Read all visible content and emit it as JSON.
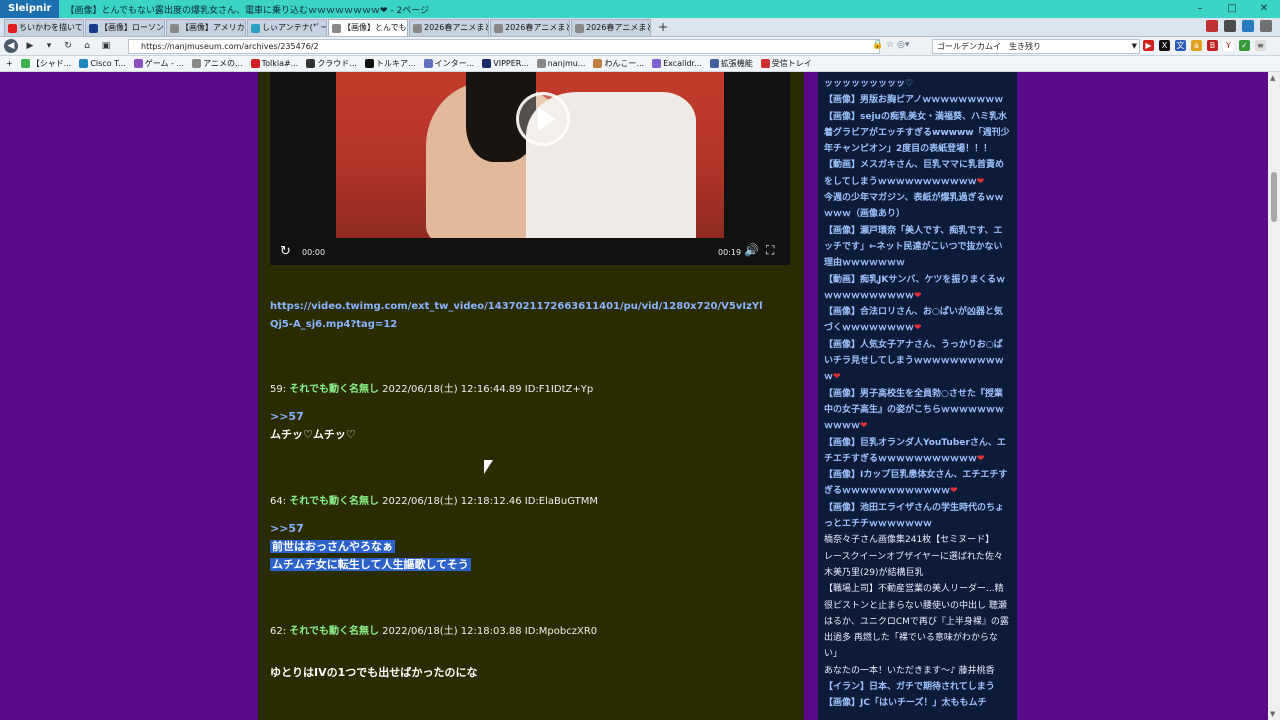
{
  "window": {
    "app_name": "Sleipnir",
    "title": "【画像】とんでもない露出度の爆乳女さん、電車に乗り込むｗｗｗｗｗｗｗｗ❤ - 2ページ",
    "controls": {
      "minimize": "–",
      "maximize": "□",
      "close": "✕"
    }
  },
  "tabs": [
    {
      "label": "ちいかわを描いて...",
      "color": "#e02020",
      "active": false
    },
    {
      "label": "【画像】ローソンの...",
      "color": "#1a3c8c",
      "active": false
    },
    {
      "label": "【画像】アメリカの...",
      "color": "#888888",
      "active": false
    },
    {
      "label": "しぃアンテナ(*ﾟー)",
      "color": "#2aa0c0",
      "active": false
    },
    {
      "label": "【画像】とんでもな...",
      "color": "#888888",
      "active": true
    },
    {
      "label": "2026春アニメまと...",
      "color": "#888888",
      "active": false
    },
    {
      "label": "2026春アニメまと...",
      "color": "#888888",
      "active": false
    },
    {
      "label": "2026春アニメまと...",
      "color": "#888888",
      "active": false
    }
  ],
  "tab_new": "+",
  "address": {
    "url": "https://nanjmuseum.com/archives/235476/2",
    "search_value": "ゴールデンカムイ　生き残り"
  },
  "bookmarks": [
    {
      "label": "【シャド...",
      "color": "#3cb04a"
    },
    {
      "label": "Cisco T...",
      "color": "#1e88c0"
    },
    {
      "label": "ゲーム - ...",
      "color": "#8a50c0"
    },
    {
      "label": "アニメの...",
      "color": "#888888"
    },
    {
      "label": "Tolkia#...",
      "color": "#d02020"
    },
    {
      "label": "クラウド...",
      "color": "#333333"
    },
    {
      "label": "トルキア...",
      "color": "#111111"
    },
    {
      "label": "インター...",
      "color": "#6070c0"
    },
    {
      "label": "VIPPER...",
      "color": "#1a2a6c"
    },
    {
      "label": "nanjmu...",
      "color": "#888888"
    },
    {
      "label": "わんこー...",
      "color": "#c08040"
    },
    {
      "label": "Excalidr...",
      "color": "#7a60d0"
    },
    {
      "label": "拡張機能",
      "color": "#4060a0"
    },
    {
      "label": "受信トレイ",
      "color": "#d03030"
    }
  ],
  "video": {
    "time_current": "00:00",
    "time_duration": "00:19"
  },
  "video_link": "https://video.twimg.com/ext_tw_video/1437021172663611401/pu/vid/1280x720/V5vIzYlQj5-A_sj6.mp4?tag=12",
  "posts": [
    {
      "number": "59:",
      "name": "それでも動く名無し",
      "datetime": "2022/06/18(土) 12:16:44.89 ID:F1IDtZ+Yp",
      "ref": ">>57",
      "lines": [
        "ムチッ♡ムチッ♡"
      ]
    },
    {
      "number": "64:",
      "name": "それでも動く名無し",
      "datetime": "2022/06/18(土) 12:18:12.46 ID:ElaBuGTMM",
      "ref": ">>57",
      "lines": [
        "前世はおっさんやろなぁ",
        "ムチムチ女に転生して人生謳歌してそう"
      ]
    },
    {
      "number": "62:",
      "name": "それでも動く名無し",
      "datetime": "2022/06/18(土) 12:18:03.88 ID:MpobczXR0",
      "ref": "",
      "lines": [
        "ゆとりはIVの1つでも出せばかったのにな"
      ]
    }
  ],
  "sidebar": {
    "items": [
      {
        "text": "ッッッッッッッッッ♡",
        "heart": false,
        "white": false
      },
      {
        "text": "【画像】男版お胸ピアノｗｗｗｗｗｗｗｗｗ",
        "heart": false,
        "white": false
      },
      {
        "text": "【画像】sejuの痴乳美女・満福葵、ハミ乳水着グラビアがエッチすぎるwwwww「週刊少年チャンピオン」2度目の表紙登場！！！",
        "heart": false,
        "white": false
      },
      {
        "text": "【動画】メスガキさん、巨乳ママに乳首責めをしてしまうｗｗｗｗｗｗｗｗｗｗｗ",
        "heart": true,
        "white": false
      },
      {
        "text": "今週の少年マガジン、表紙が爆乳過ぎるｗｗｗｗｗ（画像あり）",
        "heart": false,
        "white": false
      },
      {
        "text": "【画像】瀬戸環奈「美人です、痴乳です、エッチです」←ネット民達がこいつで抜かない理由ｗｗｗｗｗｗｗ",
        "heart": false,
        "white": false
      },
      {
        "text": "【動画】痴乳JKサンバ、ケツを振りまくるｗｗｗｗｗｗｗｗｗｗｗ",
        "heart": true,
        "white": false
      },
      {
        "text": "【画像】合法ロリさん、お○ぱいが凶器と気づくｗｗｗｗｗｗｗｗ",
        "heart": true,
        "white": false
      },
      {
        "text": "【画像】人気女子アナさん、うっかりお○ぱいチラ見せしてしまうｗｗｗｗｗｗｗｗｗｗｗ",
        "heart": true,
        "white": false
      },
      {
        "text": "【画像】男子高校生を全員勃○させた『授業中の女子高生』の姿がこちらｗｗｗｗｗｗｗｗｗｗｗ",
        "heart": true,
        "white": false
      },
      {
        "text": "【画像】巨乳オランダ人YouTuberさん、エチエチすぎるｗｗｗｗｗｗｗｗｗｗｗ",
        "heart": true,
        "white": false
      },
      {
        "text": "【画像】Iカップ巨乳患体女さん、エチエチすぎるｗｗｗｗｗｗｗｗｗｗｗｗ",
        "heart": true,
        "white": false
      },
      {
        "text": "【画像】池田エライザさんの学生時代のちょっとエチチｗｗｗｗｗｗｗ",
        "heart": false,
        "white": false
      },
      {
        "text": "橋奈々子さん画像集241枚【セミヌード】",
        "heart": false,
        "white": true
      },
      {
        "text": "レースクイーンオブザイヤーに選ばれた佐々木美乃里(29)が結構巨乳",
        "heart": false,
        "white": true
      },
      {
        "text": "【職場上司】不動産営業の美人リーダー...精很ピストンと止まらない腰使いの中出し 聴瀬はるか、ユニクロCMで再び『上半身裸』の露出過多 再燃した「裸でいる意味がわからない」",
        "heart": false,
        "white": true
      },
      {
        "text": "あなたの一本！いただきます～♪ 藤井桃香",
        "heart": false,
        "white": true
      },
      {
        "text": "【イラン】日本、ガチで期待されてしまう",
        "heart": false,
        "white": false
      },
      {
        "text": "【画像】JC「はいチーズ！」太ももムチ",
        "heart": false,
        "white": false
      }
    ]
  }
}
